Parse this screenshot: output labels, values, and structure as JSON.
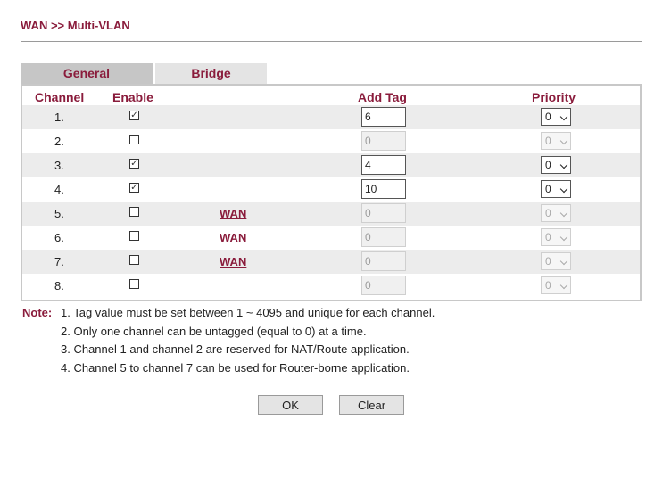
{
  "header": {
    "title": "WAN >> Multi-VLAN"
  },
  "tabs": [
    {
      "label": "General",
      "active": true
    },
    {
      "label": "Bridge",
      "active": false
    }
  ],
  "table": {
    "headers": {
      "channel": "Channel",
      "enable": "Enable",
      "add_tag": "Add Tag",
      "priority": "Priority"
    },
    "rows": [
      {
        "channel": "1.",
        "enabled": true,
        "wan": "",
        "tag": "6",
        "tag_disabled": false,
        "priority": "0",
        "priority_disabled": false
      },
      {
        "channel": "2.",
        "enabled": false,
        "wan": "",
        "tag": "0",
        "tag_disabled": true,
        "priority": "0",
        "priority_disabled": true
      },
      {
        "channel": "3.",
        "enabled": true,
        "wan": "",
        "tag": "4",
        "tag_disabled": false,
        "priority": "0",
        "priority_disabled": false
      },
      {
        "channel": "4.",
        "enabled": true,
        "wan": "",
        "tag": "10",
        "tag_disabled": false,
        "priority": "0",
        "priority_disabled": false
      },
      {
        "channel": "5.",
        "enabled": false,
        "wan": "WAN",
        "tag": "0",
        "tag_disabled": true,
        "priority": "0",
        "priority_disabled": true
      },
      {
        "channel": "6.",
        "enabled": false,
        "wan": "WAN",
        "tag": "0",
        "tag_disabled": true,
        "priority": "0",
        "priority_disabled": true
      },
      {
        "channel": "7.",
        "enabled": false,
        "wan": "WAN",
        "tag": "0",
        "tag_disabled": true,
        "priority": "0",
        "priority_disabled": true
      },
      {
        "channel": "8.",
        "enabled": false,
        "wan": "",
        "tag": "0",
        "tag_disabled": true,
        "priority": "0",
        "priority_disabled": true
      }
    ]
  },
  "notes": {
    "label": "Note:",
    "lines": [
      "1. Tag value must be set between 1 ~ 4095 and unique for each channel.",
      "2. Only one channel can be untagged (equal to 0) at a time.",
      "3. Channel 1 and channel 2 are reserved for NAT/Route application.",
      "4. Channel 5 to channel 7 can be used for Router-borne application."
    ]
  },
  "buttons": {
    "ok": "OK",
    "clear": "Clear"
  },
  "colors": {
    "accent": "#8a1c3c",
    "row_shade": "#ececec",
    "tab_active": "#c6c6c6",
    "tab_inactive": "#e4e4e4"
  }
}
